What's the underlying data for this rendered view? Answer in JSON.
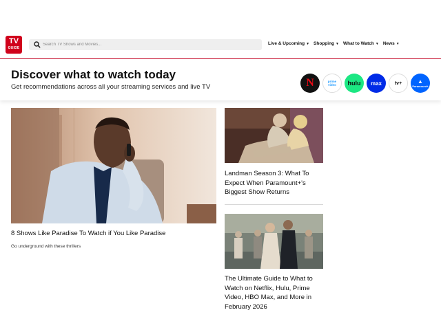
{
  "header": {
    "logo": {
      "line1": "TV",
      "line2": "GUIDE"
    },
    "search": {
      "placeholder": "Search TV Shows and Movies..."
    },
    "nav": [
      {
        "label": "Live & Upcoming"
      },
      {
        "label": "Shopping"
      },
      {
        "label": "What to Watch"
      },
      {
        "label": "News"
      }
    ]
  },
  "discover": {
    "title": "Discover what to watch today",
    "subtitle": "Get recommendations across all your streaming services and live TV",
    "services": [
      {
        "name": "netflix-icon",
        "label": "N"
      },
      {
        "name": "prime-video-icon",
        "label": "prime video"
      },
      {
        "name": "hulu-icon",
        "label": "hulu"
      },
      {
        "name": "max-icon",
        "label": "max"
      },
      {
        "name": "apple-tv-icon",
        "label": "tv+"
      },
      {
        "name": "paramount-plus-icon",
        "label": "Paramount+"
      }
    ]
  },
  "hero": {
    "title": "8 Shows Like Paradise To Watch if You Like Paradise",
    "subtitle": "Go underground with these thrillers"
  },
  "cards": [
    {
      "title": "Landman Season 3: What To Expect When Paramount+'s Biggest Show Returns"
    },
    {
      "title": "The Ultimate Guide to What to Watch on Netflix, Hulu, Prime Video, HBO Max, and More in February 2026"
    }
  ],
  "colors": {
    "brand_red": "#d0021b",
    "header_rule": "#c8102e"
  }
}
